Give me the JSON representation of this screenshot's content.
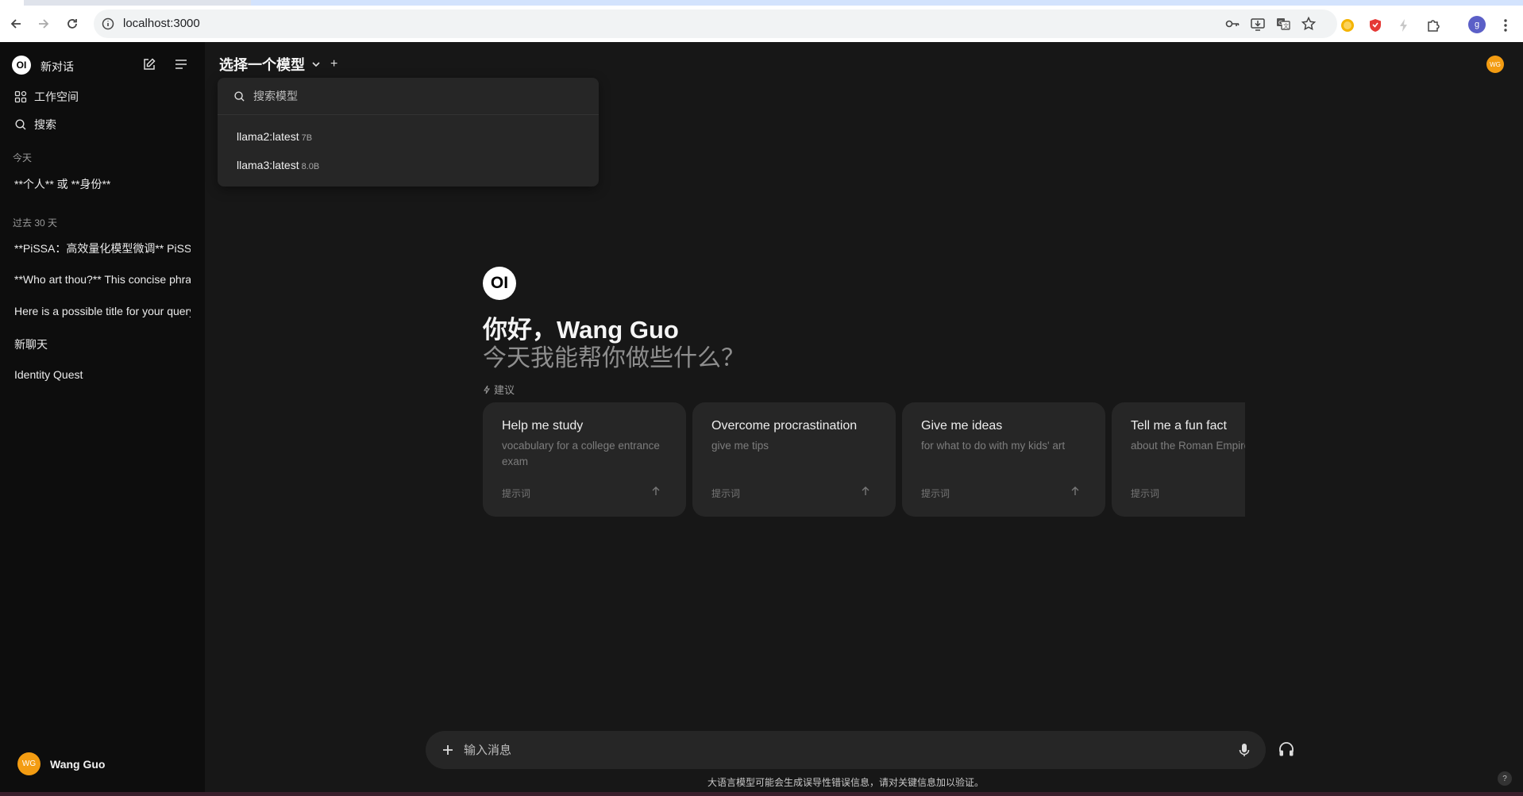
{
  "browser": {
    "url": "localhost:3000",
    "profile_initial": "g"
  },
  "sidebar": {
    "new_chat_label": "新对话",
    "workspace_label": "工作空间",
    "search_label": "搜索",
    "sections": [
      {
        "label": "今天",
        "chats": [
          "**个人** 或 **身份**"
        ]
      },
      {
        "label": "过去 30 天",
        "chats": [
          "**PiSSA：高效量化模型微调** PiSSA",
          "**Who art thou?** This concise phrase",
          "Here is a possible title for your query",
          "新聊天",
          "Identity Quest"
        ]
      }
    ],
    "user": {
      "initials": "WG",
      "name": "Wang Guo"
    }
  },
  "header": {
    "model_select_label": "选择一个模型",
    "plus": "+",
    "avatar_initials": "WG"
  },
  "model_dropdown": {
    "search_placeholder": "搜索模型",
    "models": [
      {
        "name": "llama2:latest",
        "size": "7B"
      },
      {
        "name": "llama3:latest",
        "size": "8.0B"
      }
    ]
  },
  "hero": {
    "logo_text": "OI",
    "greeting": "你好，Wang Guo",
    "subtitle": "今天我能帮你做些什么？",
    "suggestions_label": "建议"
  },
  "suggestions": [
    {
      "title": "Help me study",
      "subtitle": "vocabulary for a college entrance exam",
      "prompt_label": "提示词"
    },
    {
      "title": "Overcome procrastination",
      "subtitle": "give me tips",
      "prompt_label": "提示词"
    },
    {
      "title": "Give me ideas",
      "subtitle": "for what to do with my kids' art",
      "prompt_label": "提示词"
    },
    {
      "title": "Tell me a fun fact",
      "subtitle": "about the Roman Empire",
      "prompt_label": "提示词"
    }
  ],
  "chat_input": {
    "placeholder": "输入消息",
    "value": ""
  },
  "footer": {
    "disclaimer": "大语言模型可能会生成误导性错误信息，请对关键信息加以验证。",
    "help": "?"
  }
}
